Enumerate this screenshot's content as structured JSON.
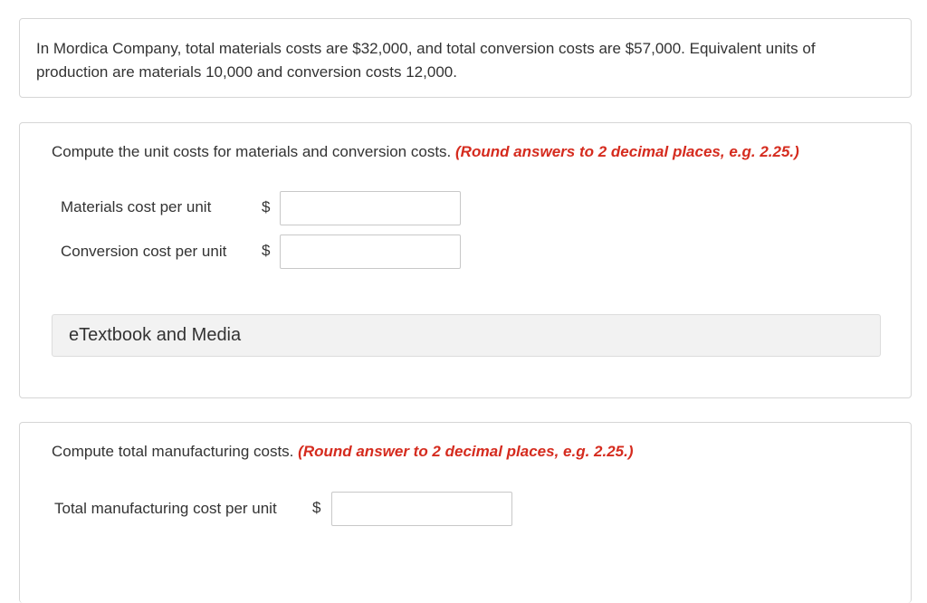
{
  "problem": {
    "text": "In Mordica Company, total materials costs are $32,000, and total conversion costs are $57,000. Equivalent units of production are materials 10,000 and conversion costs 12,000."
  },
  "part1": {
    "question": "Compute the unit costs for materials and conversion costs.",
    "hint": "(Round answers to 2 decimal places, e.g. 2.25.)",
    "fields": [
      {
        "label": "Materials cost per unit",
        "currency": "$",
        "value": ""
      },
      {
        "label": "Conversion cost per unit",
        "currency": "$",
        "value": ""
      }
    ],
    "etextbook_label": "eTextbook and Media"
  },
  "part2": {
    "question": "Compute total manufacturing costs.",
    "hint": "(Round answer to 2 decimal places, e.g. 2.25.)",
    "fields": [
      {
        "label": "Total manufacturing cost per unit",
        "currency": "$",
        "value": ""
      }
    ]
  },
  "colors": {
    "hint": "#d52b1e",
    "border": "#d6d6d6",
    "etext_bg": "#f2f2f2"
  }
}
